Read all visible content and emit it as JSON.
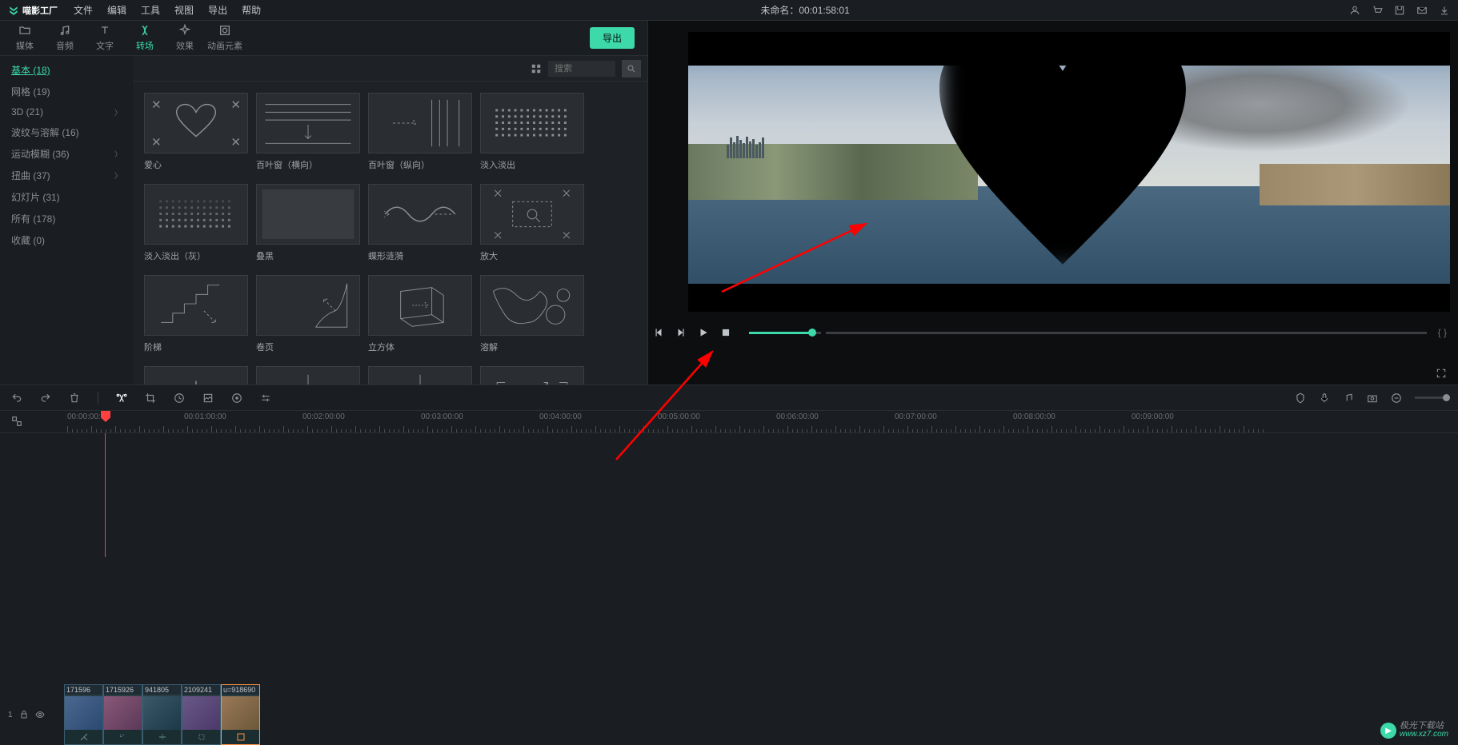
{
  "titlebar": {
    "logo": "喵影工厂",
    "menu": [
      "文件",
      "编辑",
      "工具",
      "视图",
      "导出",
      "帮助"
    ],
    "project_name": "未命名：",
    "timecode": "00:01:58:01"
  },
  "tabs": {
    "items": [
      {
        "label": "媒体",
        "icon": "folder"
      },
      {
        "label": "音频",
        "icon": "music"
      },
      {
        "label": "文字",
        "icon": "text"
      },
      {
        "label": "转场",
        "icon": "transition",
        "active": true
      },
      {
        "label": "效果",
        "icon": "effect"
      },
      {
        "label": "动画元素",
        "icon": "element"
      }
    ],
    "export": "导出"
  },
  "sidebar": {
    "items": [
      {
        "label": "基本 (18)",
        "active": true
      },
      {
        "label": "网格 (19)"
      },
      {
        "label": "3D (21)",
        "chevron": true
      },
      {
        "label": "波纹与溶解 (16)"
      },
      {
        "label": "运动模糊 (36)",
        "chevron": true
      },
      {
        "label": "扭曲 (37)",
        "chevron": true
      },
      {
        "label": "幻灯片 (31)"
      },
      {
        "label": "所有 (178)"
      },
      {
        "label": "收藏 (0)"
      }
    ]
  },
  "search": {
    "placeholder": "搜索"
  },
  "grid": {
    "items": [
      {
        "label": "爱心",
        "type": "heart"
      },
      {
        "label": "百叶窗（横向）",
        "type": "blinds-h"
      },
      {
        "label": "百叶窗（纵向）",
        "type": "blinds-v"
      },
      {
        "label": "淡入淡出",
        "type": "fade"
      },
      {
        "label": "淡入淡出（灰）",
        "type": "fade-gray"
      },
      {
        "label": "叠黑",
        "type": "black"
      },
      {
        "label": "蝶形涟漪",
        "type": "ripple"
      },
      {
        "label": "放大",
        "type": "zoom"
      },
      {
        "label": "阶梯",
        "type": "stairs"
      },
      {
        "label": "卷页",
        "type": "page"
      },
      {
        "label": "立方体",
        "type": "cube"
      },
      {
        "label": "溶解",
        "type": "dissolve"
      },
      {
        "label": "",
        "type": "burst"
      },
      {
        "label": "",
        "type": "arrows-out"
      },
      {
        "label": "",
        "type": "arrows-dash"
      },
      {
        "label": "",
        "type": "corners"
      }
    ]
  },
  "preview": {
    "brackets": "{  }"
  },
  "ruler": {
    "start": "00:00:00:00",
    "marks": [
      "00:01:00:00",
      "00:02:00:00",
      "00:03:00:00",
      "00:04:00:00",
      "00:05:00:00",
      "00:06:00:00",
      "00:07:00:00",
      "00:08:00:00",
      "00:09:00:00"
    ]
  },
  "clips": {
    "track_id": "1",
    "items": [
      {
        "label": "171596"
      },
      {
        "label": "1715926"
      },
      {
        "label": "941805"
      },
      {
        "label": "2109241"
      },
      {
        "label": "u=918690",
        "selected": true
      }
    ]
  },
  "watermark": {
    "cn": "极光下载站",
    "url": "www.xz7.com"
  }
}
